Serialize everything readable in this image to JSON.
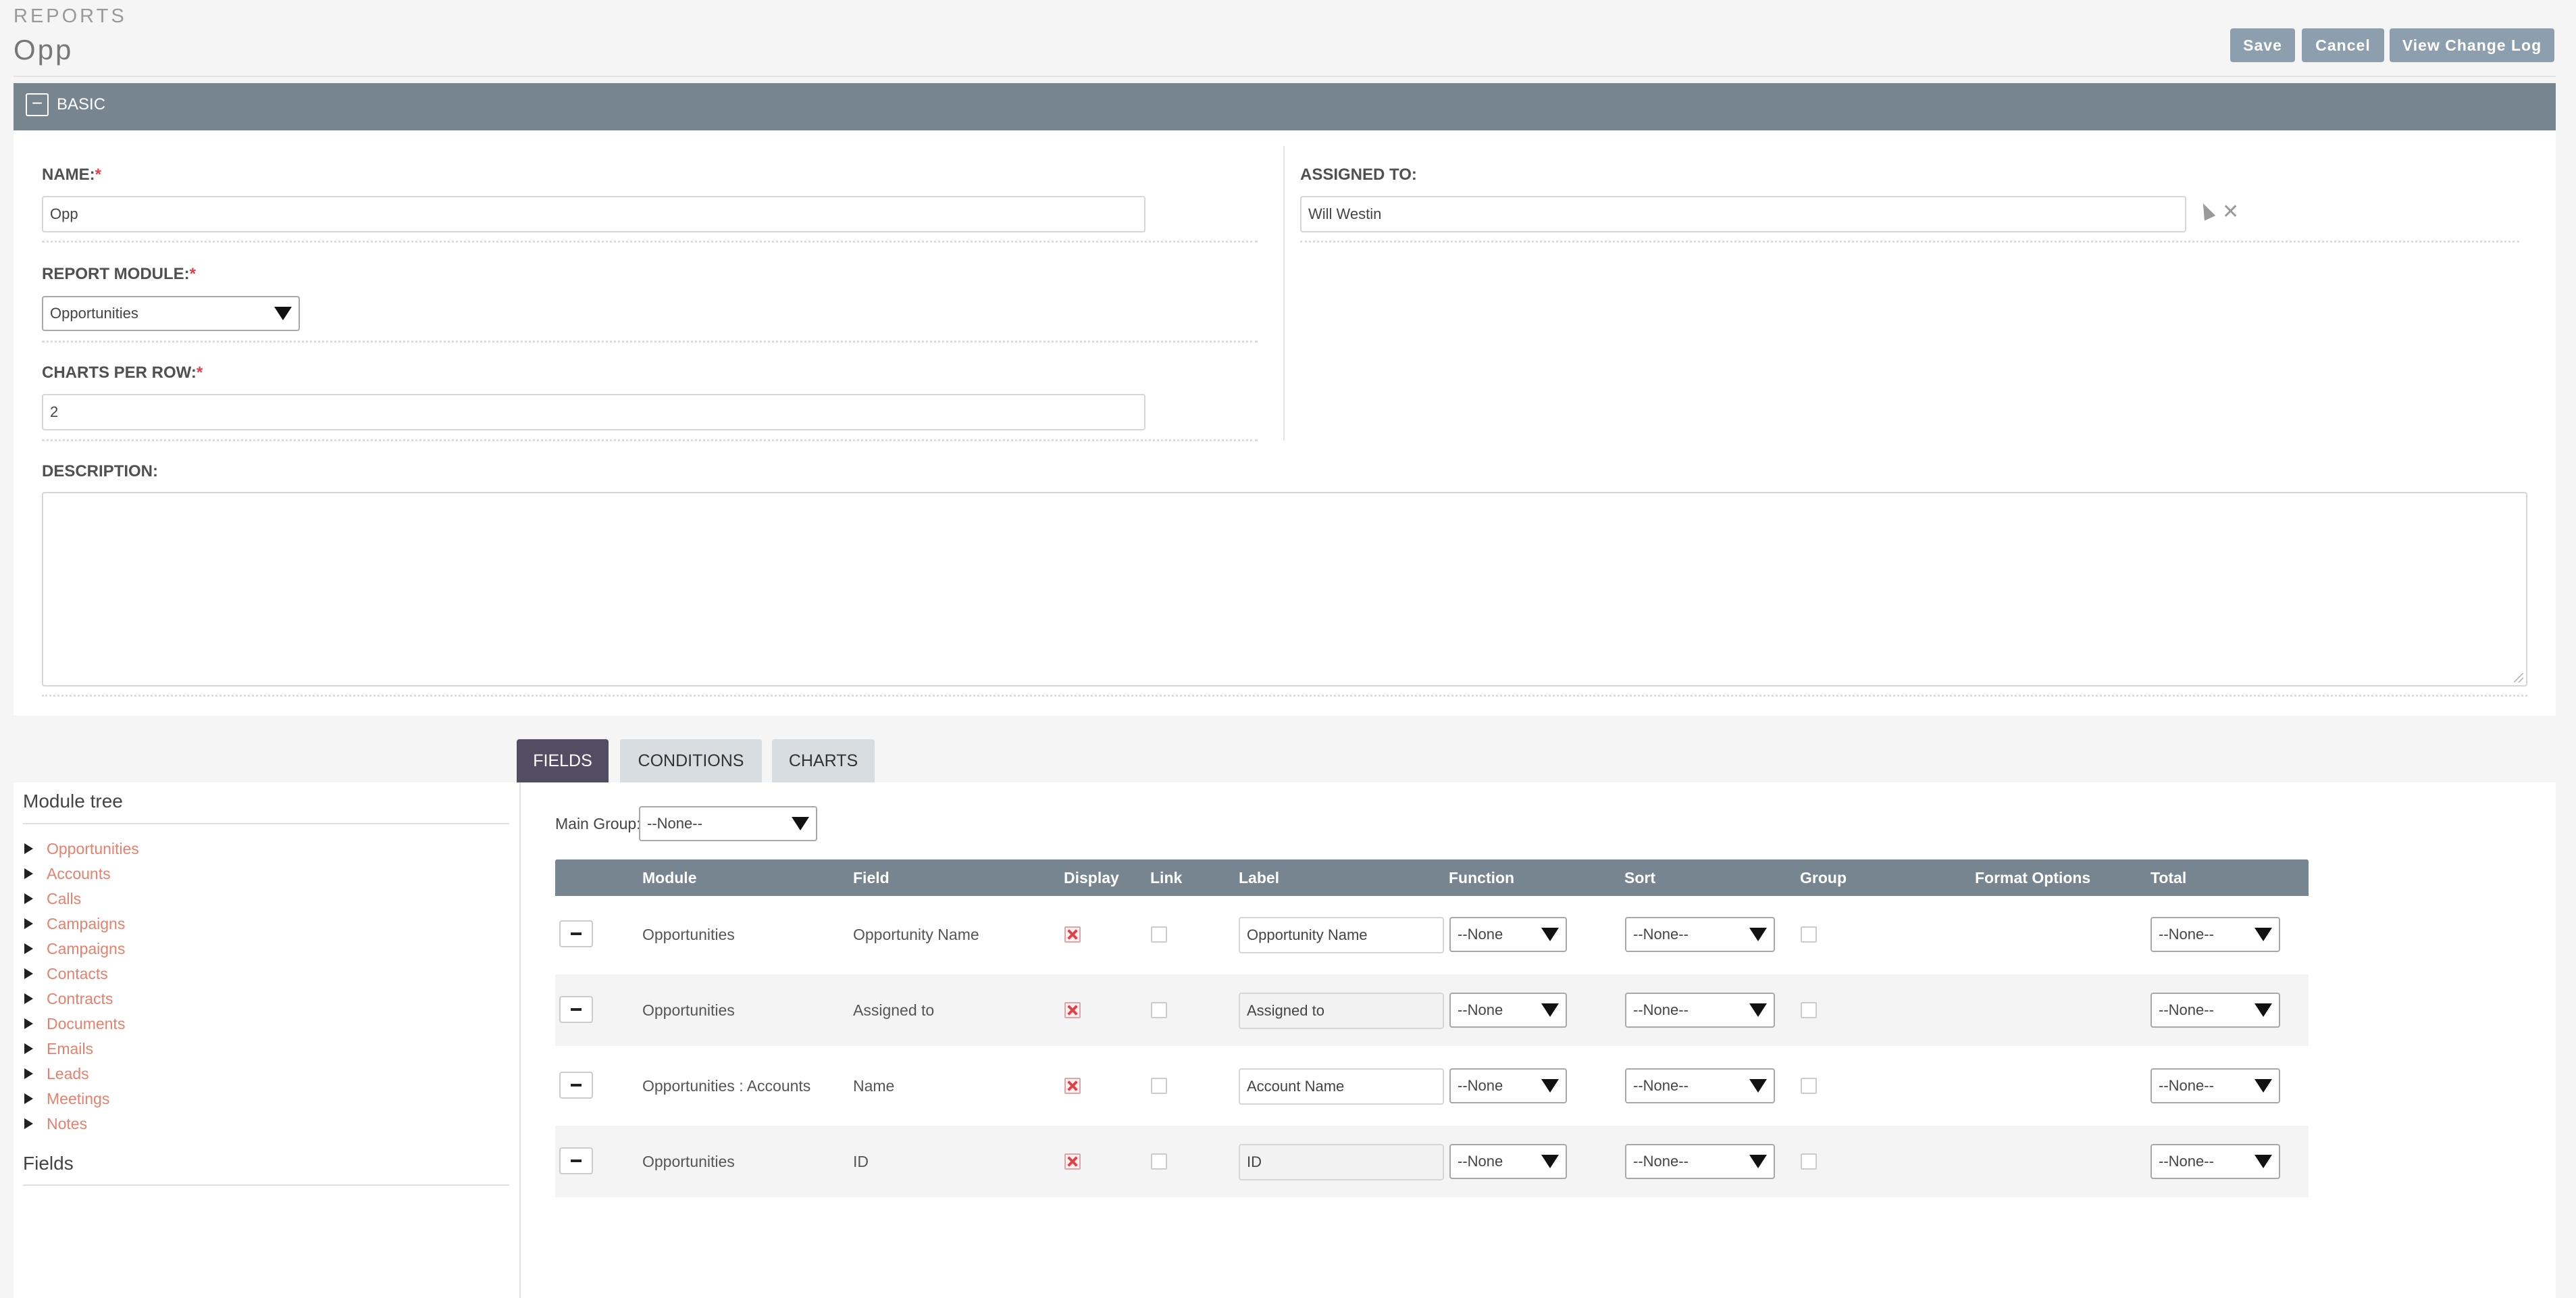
{
  "header": {
    "module": "REPORTS",
    "record_title": "Opp",
    "buttons": {
      "save": "Save",
      "cancel": "Cancel",
      "change_log": "View Change Log"
    }
  },
  "panel": {
    "title": "BASIC",
    "collapse_symbol": "−",
    "fields": {
      "name": {
        "label": "NAME:",
        "required": "*",
        "value": "Opp"
      },
      "report_module": {
        "label": "REPORT MODULE:",
        "required": "*",
        "value": "Opportunities"
      },
      "charts_per_row": {
        "label": "CHARTS PER ROW:",
        "required": "*",
        "value": "2"
      },
      "assigned_to": {
        "label": "ASSIGNED TO:",
        "value": "Will Westin"
      },
      "description": {
        "label": "DESCRIPTION:",
        "value": ""
      }
    }
  },
  "tabs": [
    {
      "label": "FIELDS",
      "active": true
    },
    {
      "label": "CONDITIONS",
      "active": false
    },
    {
      "label": "CHARTS",
      "active": false
    }
  ],
  "tree": {
    "module_tree_title": "Module tree",
    "items": [
      "Opportunities",
      "Accounts",
      "Calls",
      "Campaigns",
      "Campaigns",
      "Contacts",
      "Contracts",
      "Documents",
      "Emails",
      "Leads",
      "Meetings",
      "Notes"
    ],
    "fields_title": "Fields"
  },
  "fields_tab": {
    "main_group_label": "Main Group:",
    "main_group_value": "--None--",
    "columns": [
      "Module",
      "Field",
      "Display",
      "Link",
      "Label",
      "Function",
      "Sort",
      "Group",
      "Format Options",
      "Total"
    ],
    "rows": [
      {
        "module": "Opportunities",
        "field": "Opportunity Name",
        "display": true,
        "link": false,
        "label": "Opportunity Name",
        "label_readonly": false,
        "function": "--None",
        "sort": "--None--",
        "group": false,
        "total": "--None--"
      },
      {
        "module": "Opportunities",
        "field": "Assigned to",
        "display": true,
        "link": false,
        "label": "Assigned to",
        "label_readonly": true,
        "function": "--None",
        "sort": "--None--",
        "group": false,
        "total": "--None--"
      },
      {
        "module": "Opportunities : Accounts",
        "field": "Name",
        "display": true,
        "link": false,
        "label": "Account Name",
        "label_readonly": false,
        "function": "--None",
        "sort": "--None--",
        "group": false,
        "total": "--None--"
      },
      {
        "module": "Opportunities",
        "field": "ID",
        "display": true,
        "link": false,
        "label": "ID",
        "label_readonly": true,
        "function": "--None",
        "sort": "--None--",
        "group": false,
        "total": "--None--"
      }
    ]
  },
  "icons": {
    "collapse": "minus-square-icon",
    "select_user": "cursor-arrow-icon",
    "clear_user": "close-icon",
    "tree_expand": "triangle-right-icon",
    "dropdown": "caret-down-icon",
    "remove_row": "minus-icon",
    "checked": "x-mark-icon"
  },
  "colors": {
    "panel_header": "#778591",
    "active_tab": "#534d64",
    "button": "#8d9fae",
    "link": "#e8806c",
    "required": "#e0414a"
  }
}
